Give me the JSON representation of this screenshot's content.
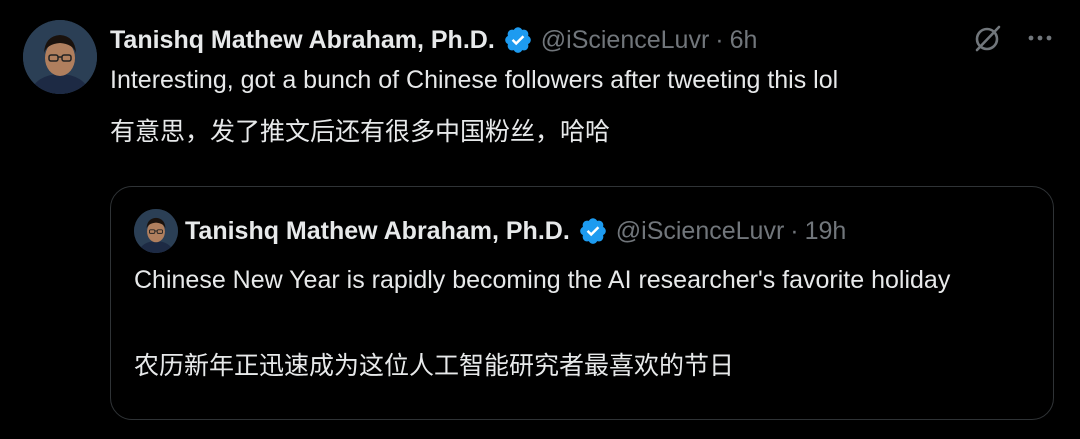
{
  "tweet": {
    "author_name": "Tanishq Mathew Abraham, Ph.D.",
    "handle": "@iScienceLuvr",
    "separator": "·",
    "time": "6h",
    "text_en": "Interesting, got a bunch of Chinese followers after tweeting this lol",
    "text_zh": "有意思，发了推文后还有很多中国粉丝，哈哈",
    "verified_icon": "verified-badge-icon",
    "grok_icon": "grok-icon",
    "more_icon": "more-options-icon"
  },
  "quoted_tweet": {
    "author_name": "Tanishq Mathew Abraham, Ph.D.",
    "handle": "@iScienceLuvr",
    "separator": "·",
    "time": "19h",
    "text_en": "Chinese New Year is rapidly becoming the AI researcher's favorite holiday",
    "text_zh": "农历新年正迅速成为这位人工智能研究者最喜欢的节日"
  },
  "colors": {
    "background": "#000000",
    "text": "#e7e9ea",
    "secondary": "#71767b",
    "verified": "#1d9bf0",
    "border": "#2f3336"
  }
}
